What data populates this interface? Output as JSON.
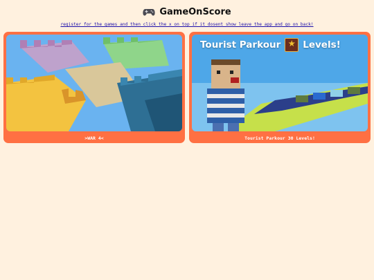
{
  "header": {
    "icon": "gamepad-icon",
    "title": "GameOnScore"
  },
  "notice": {
    "text": "register for the games and then click the x on top if it dosent show leave the app and go on back!"
  },
  "games": [
    {
      "label": ">WAR 4<",
      "thumbnail": "blocky castles scene"
    },
    {
      "label": "Tourist Parkour 30 Levels!",
      "thumbnail_text": "Tourist Parkour",
      "thumbnail_text2": "Levels!"
    }
  ],
  "colors": {
    "background": "#fff1df",
    "card": "#ff7043",
    "link": "#1a0dab"
  }
}
